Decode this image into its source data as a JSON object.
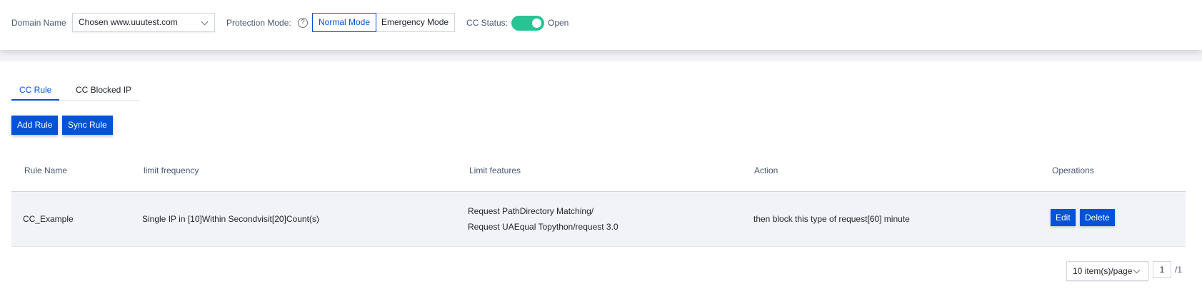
{
  "header": {
    "domain_label": "Domain Name",
    "domain_value": "Chosen www.uuutest.com",
    "protection_label": "Protection Mode:",
    "help_icon": "?",
    "modes": [
      "Normal Mode",
      "Emergency Mode"
    ],
    "selected_mode": "Normal Mode",
    "cc_status_label": "CC Status:",
    "cc_status_value": "Open",
    "toggle_on": true
  },
  "tabs": [
    "CC Rule",
    "CC Blocked IP"
  ],
  "active_tab": "CC Rule",
  "toolbar": {
    "add_rule": "Add Rule",
    "sync_rule": "Sync Rule"
  },
  "table": {
    "columns": [
      "Rule Name",
      "limit frequency",
      "Limit features",
      "Action",
      "Operations"
    ],
    "rows": [
      {
        "rule_name": "CC_Example",
        "limit_frequency": "Single IP in [10]Within Secondvisit[20]Count(s)",
        "limit_features": [
          "Request PathDirectory Matching/",
          "Request UAEqual Topython/request 3.0"
        ],
        "action": "then block this type of request[60] minute",
        "operations": [
          "Edit",
          "Delete"
        ]
      }
    ]
  },
  "pagination": {
    "page_size": "10 item(s)/page",
    "current_page": "1",
    "total": "/1"
  },
  "colors": {
    "primary": "#0052d9",
    "toggle_on": "#29c494",
    "row_bg": "#f2f3f9"
  }
}
